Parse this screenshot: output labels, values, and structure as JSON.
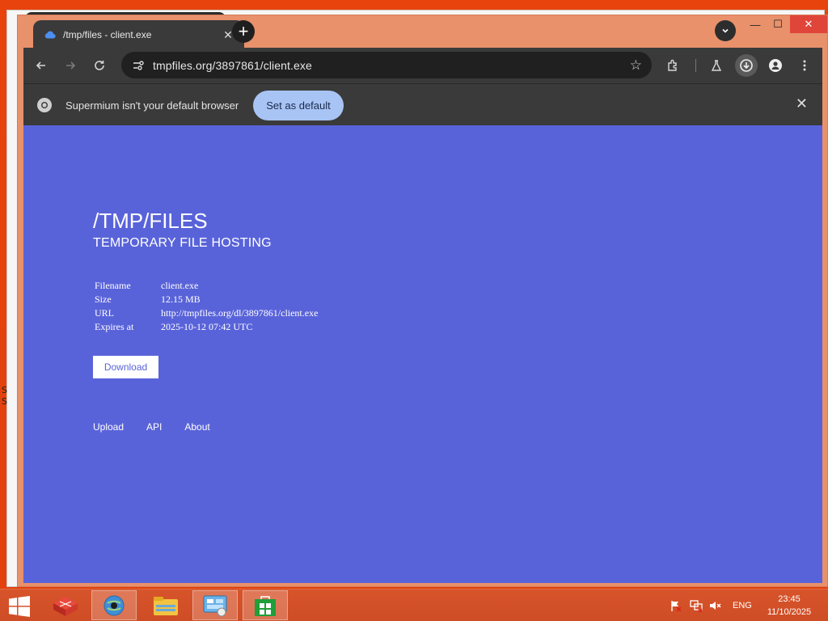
{
  "browser": {
    "tab_title": "/tmp/files - client.exe",
    "new_tab_label": "+",
    "url": "tmpfiles.org/3897861/client.exe",
    "window_controls": {
      "minimize": "—",
      "maximize": "☐",
      "close": "✕"
    }
  },
  "infobar": {
    "message": "Supermium isn't your default browser",
    "button_label": "Set as default",
    "close_label": "✕"
  },
  "page": {
    "heading": "/TMP/FILES",
    "subheading": "TEMPORARY FILE HOSTING",
    "file_info": [
      {
        "key": "Filename",
        "value": "client.exe"
      },
      {
        "key": "Size",
        "value": "12.15 MB"
      },
      {
        "key": "URL",
        "value": "http://tmpfiles.org/dl/3897861/client.exe"
      },
      {
        "key": "Expires at",
        "value": "2025-10-12 07:42 UTC"
      }
    ],
    "download_button": "Download",
    "footer_links": [
      "Upload",
      "API",
      "About"
    ],
    "background_color": "#5963d9"
  },
  "desktop_edge_text": [
    "S",
    "S"
  ],
  "taskbar": {
    "tray_language": "ENG",
    "time": "23:45",
    "date": "11/10/2025",
    "apps": [
      "app-1",
      "ie-browser",
      "file-explorer",
      "control-panel",
      "store"
    ]
  },
  "colors": {
    "accent_orange": "#e8420c",
    "window_frame": "#e8916b",
    "toolbar_dark": "#3a3a3a",
    "set_default_blue": "#a8c4f5"
  }
}
